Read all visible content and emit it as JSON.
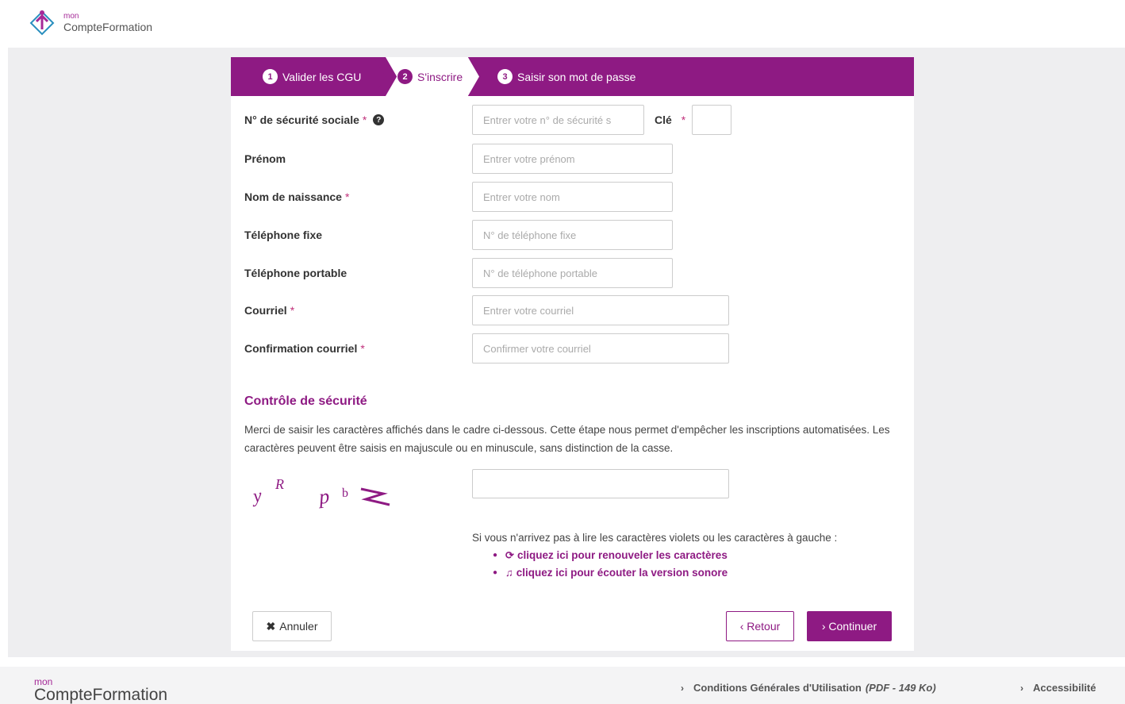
{
  "header": {
    "logo_small": "mon",
    "logo_main": "CompteFormation"
  },
  "steps": [
    {
      "num": "1",
      "label": "Valider les CGU",
      "active": false
    },
    {
      "num": "2",
      "label": "S'inscrire",
      "active": true
    },
    {
      "num": "3",
      "label": "Saisir son mot de passe",
      "active": false
    }
  ],
  "colors": {
    "accent": "#8e1a83",
    "required": "#c0307a",
    "background": "#eeeef0"
  },
  "form": {
    "nss": {
      "label": "N° de sécurité sociale",
      "required": "*",
      "help": "?",
      "placeholder": "Entrer votre n° de sécurité s",
      "cle_label": "Clé",
      "cle_required": "*"
    },
    "prenom": {
      "label": "Prénom",
      "placeholder": "Entrer votre prénom"
    },
    "nom": {
      "label": "Nom de naissance",
      "required": "*",
      "placeholder": "Entrer votre nom"
    },
    "tel_fixe": {
      "label": "Téléphone fixe",
      "placeholder": "N° de téléphone fixe"
    },
    "tel_portable": {
      "label": "Téléphone portable",
      "placeholder": "N° de téléphone portable"
    },
    "courriel": {
      "label": "Courriel",
      "required": "*",
      "placeholder": "Entrer votre courriel"
    },
    "confirmation": {
      "label": "Confirmation courriel",
      "required": "*",
      "placeholder": "Confirmer votre courriel"
    }
  },
  "security": {
    "title": "Contrôle de sécurité",
    "description": "Merci de saisir les caractères affichés dans le cadre ci-dessous. Cette étape nous permet d'empêcher les inscriptions automatisées. Les caractères peuvent être saisis en majuscule ou en minuscule, sans distinction de la casse.",
    "captcha_text": "yRpb≷",
    "help_intro": "Si vous n'arrivez pas à lire les caractères violets ou les caractères à gauche :",
    "renew_link": "cliquez ici pour renouveler les caractères",
    "audio_link": "cliquez ici pour écouter la version sonore"
  },
  "buttons": {
    "cancel": "Annuler",
    "back": "‹ Retour",
    "next": "› Continuer"
  },
  "footer": {
    "logo_small": "mon",
    "logo_main": "CompteFormation",
    "cgu": "Conditions Générales d'Utilisation",
    "cgu_pdf": "(PDF - 149 Ko)",
    "accessibility": "Accessibilité"
  }
}
